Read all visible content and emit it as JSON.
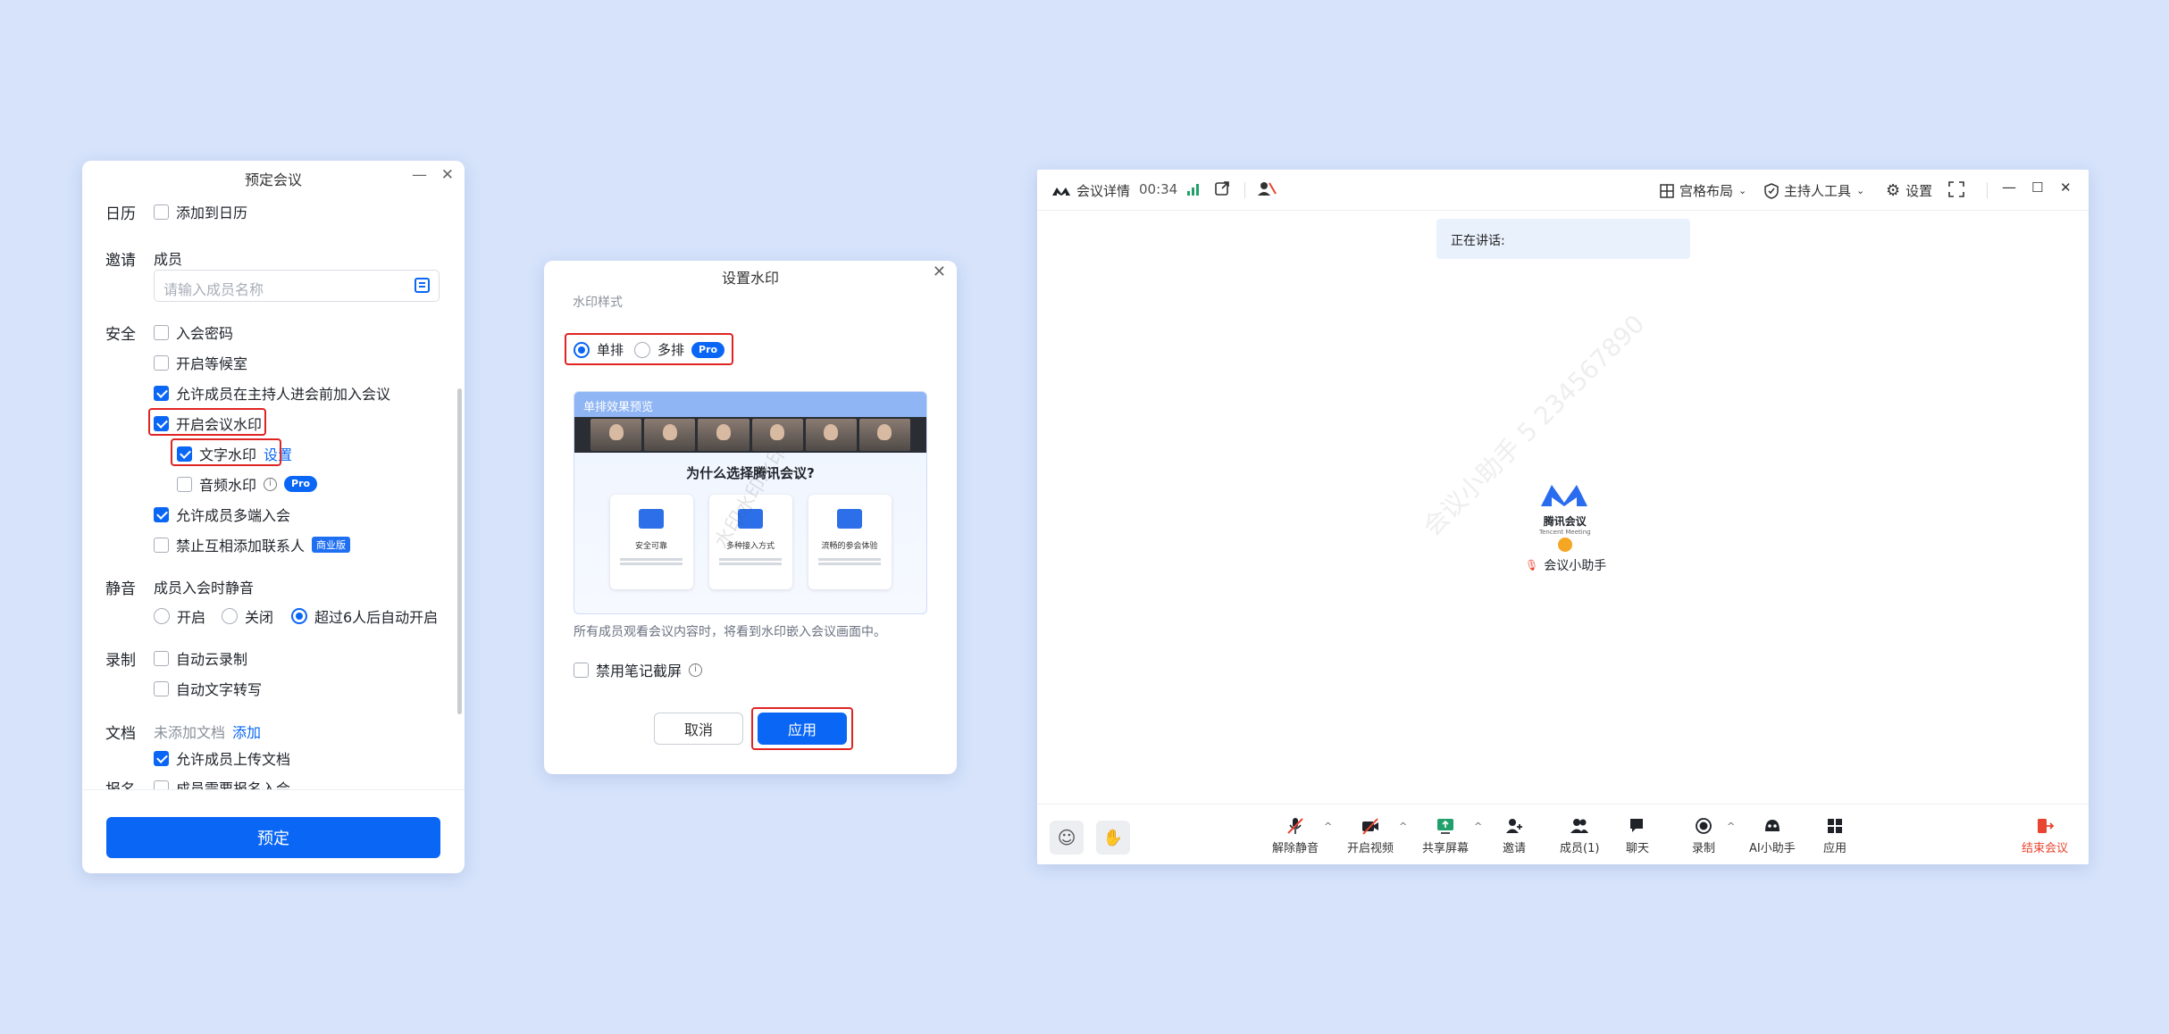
{
  "schedule": {
    "title": "预定会议",
    "calendar": {
      "label": "日历",
      "option": "添加到日历"
    },
    "invite": {
      "label": "邀请",
      "members_label": "成员",
      "placeholder": "请输入成员名称"
    },
    "security": {
      "label": "安全",
      "options": [
        "入会密码",
        "开启等候室",
        "允许成员在主持人进会前加入会议",
        "开启会议水印"
      ],
      "text_watermark": "文字水印",
      "settings_link": "设置",
      "audio_watermark": "音频水印",
      "pro_badge": "Pro",
      "multi_device": "允许成员多端入会",
      "no_add_contact": "禁止互相添加联系人",
      "biz_badge": "商业版"
    },
    "mute": {
      "label": "静音",
      "sub_label": "成员入会时静音",
      "options": [
        "开启",
        "关闭",
        "超过6人后自动开启"
      ]
    },
    "record": {
      "label": "录制",
      "options": [
        "自动云录制",
        "自动文字转写"
      ]
    },
    "docs": {
      "label": "文档",
      "none_text": "未添加文档",
      "add_link": "添加",
      "allow_upload": "允许成员上传文档"
    },
    "signup": {
      "label": "报名",
      "option": "成员需要报名入会"
    },
    "book_button": "预定"
  },
  "watermark_dialog": {
    "title": "设置水印",
    "style_label": "水印样式",
    "single": "单排",
    "multi": "多排",
    "pro_badge": "Pro",
    "preview_header": "单排效果预览",
    "preview_why": "为什么选择腾讯会议?",
    "preview_cards": [
      "安全可靠",
      "多种接入方式",
      "流畅的参会体验"
    ],
    "preview_watermark": "水印水印水印",
    "note": "所有成员观看会议内容时，将看到水印嵌入会议画面中。",
    "disable_screenshot": "禁用笔记截屏",
    "cancel": "取消",
    "apply": "应用"
  },
  "meeting": {
    "details": "会议详情",
    "timer": "00:34",
    "grid_layout": "宫格布局",
    "host_tools": "主持人工具",
    "settings": "设置",
    "speaking": "正在讲话:",
    "logo_text": "腾讯会议",
    "logo_sub": "Tencent Meeting",
    "assistant": "会议小助手",
    "watermark": "会议小助手 5 234567890",
    "toolbar": [
      "解除静音",
      "开启视频",
      "共享屏幕",
      "邀请",
      "成员(1)",
      "聊天",
      "录制",
      "AI小助手",
      "应用"
    ],
    "end_meeting": "结束会议",
    "colors": {
      "accent": "#0a66f5",
      "end": "#e8442f",
      "bg": "#d6e3fb"
    }
  }
}
